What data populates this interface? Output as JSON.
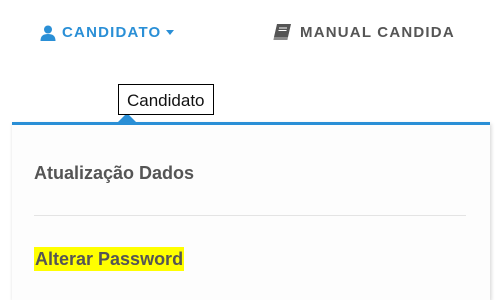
{
  "nav": {
    "candidato": {
      "label": "CANDIDATO",
      "icon": "user-icon"
    },
    "manual": {
      "label": "MANUAL CANDIDA",
      "icon": "book-icon"
    }
  },
  "tooltip": "Candidato",
  "menu": {
    "items": [
      {
        "label": "Atualização Dados"
      },
      {
        "label": "Alterar Password",
        "highlighted": true
      }
    ]
  },
  "colors": {
    "accent": "#2a8fd6",
    "text": "#555555",
    "highlight": "#ffff00"
  }
}
